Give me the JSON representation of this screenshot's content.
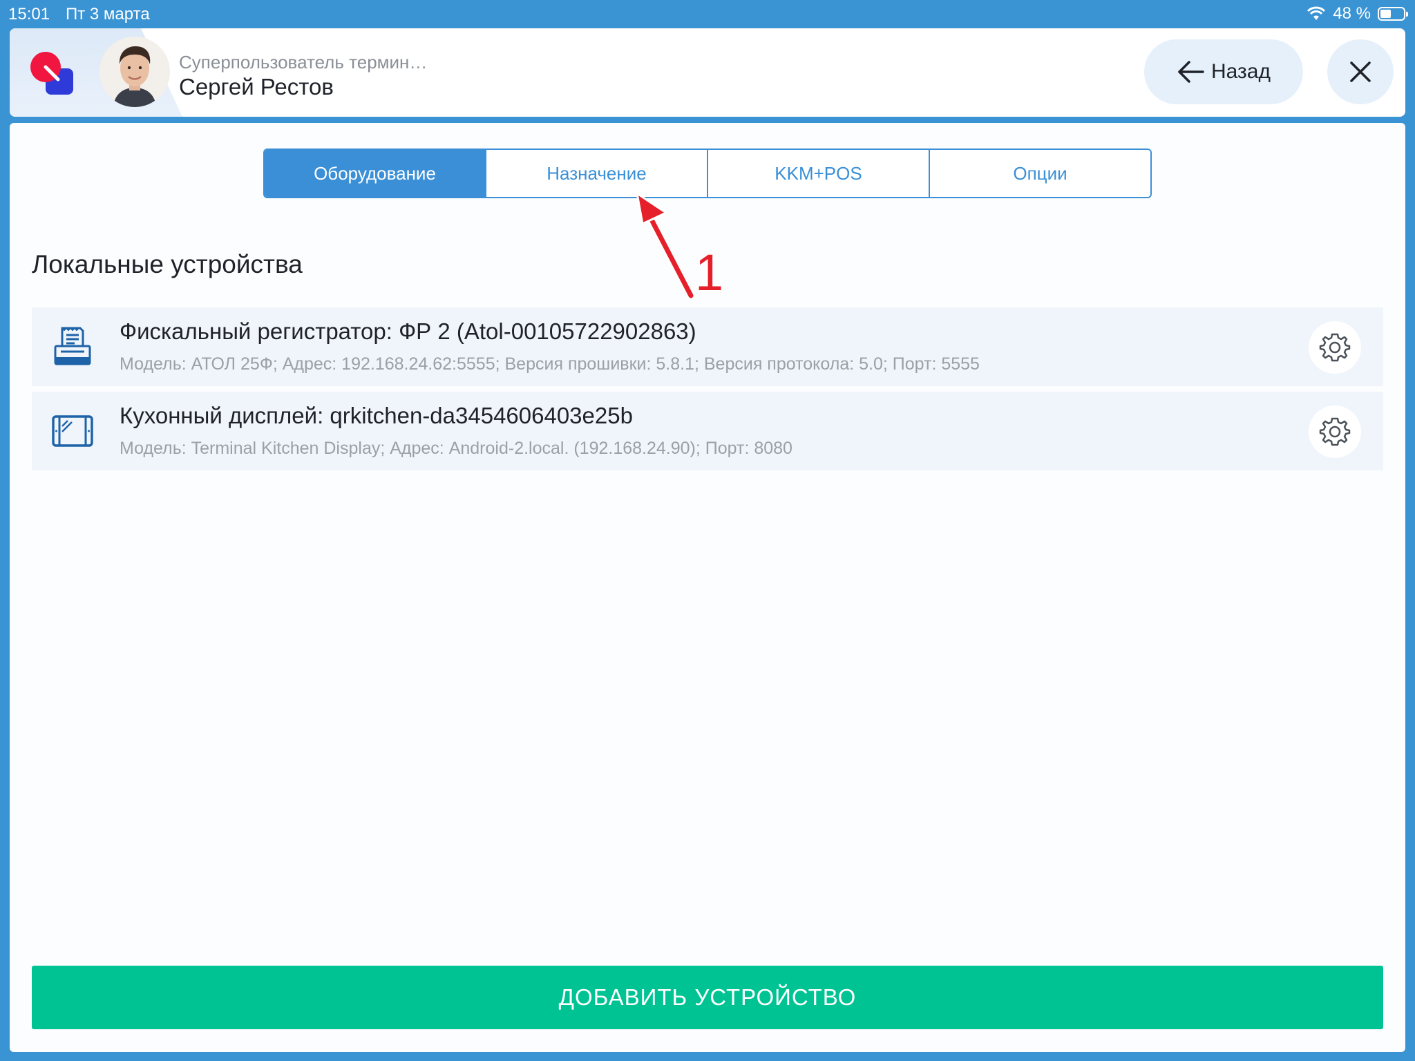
{
  "status_bar": {
    "time": "15:01",
    "date": "Пт 3 марта",
    "battery": "48 %",
    "battery_level": 0.48
  },
  "header": {
    "user_role": "Суперпользователь термин…",
    "user_name": "Сергей Рестов",
    "back_label": "Назад"
  },
  "tabs": [
    {
      "label": "Оборудование",
      "active": true
    },
    {
      "label": "Назначение",
      "active": false
    },
    {
      "label": "KKM+POS",
      "active": false
    },
    {
      "label": "Опции",
      "active": false
    }
  ],
  "section_title": "Локальные устройства",
  "devices": [
    {
      "icon": "fiscal-printer-icon",
      "title": "Фискальный регистратор: ФР 2 (Atol-00105722902863)",
      "subtitle": "Модель: АТОЛ 25Ф; Адрес: 192.168.24.62:5555; Версия прошивки: 5.8.1; Версия протокола: 5.0; Порт: 5555"
    },
    {
      "icon": "tablet-display-icon",
      "title": "Кухонный дисплей: qrkitchen-da3454606403e25b",
      "subtitle": "Модель: Terminal Kitchen Display; Адрес: Android-2.local. (192.168.24.90); Порт: 8080"
    }
  ],
  "add_button_label": "ДОБАВИТЬ УСТРОЙСТВО",
  "annotation": {
    "number": "1"
  },
  "colors": {
    "accent": "#3a8fd6",
    "primary_action": "#00c394",
    "annotation": "#e5202a",
    "status_bar": "#3a93d3"
  }
}
